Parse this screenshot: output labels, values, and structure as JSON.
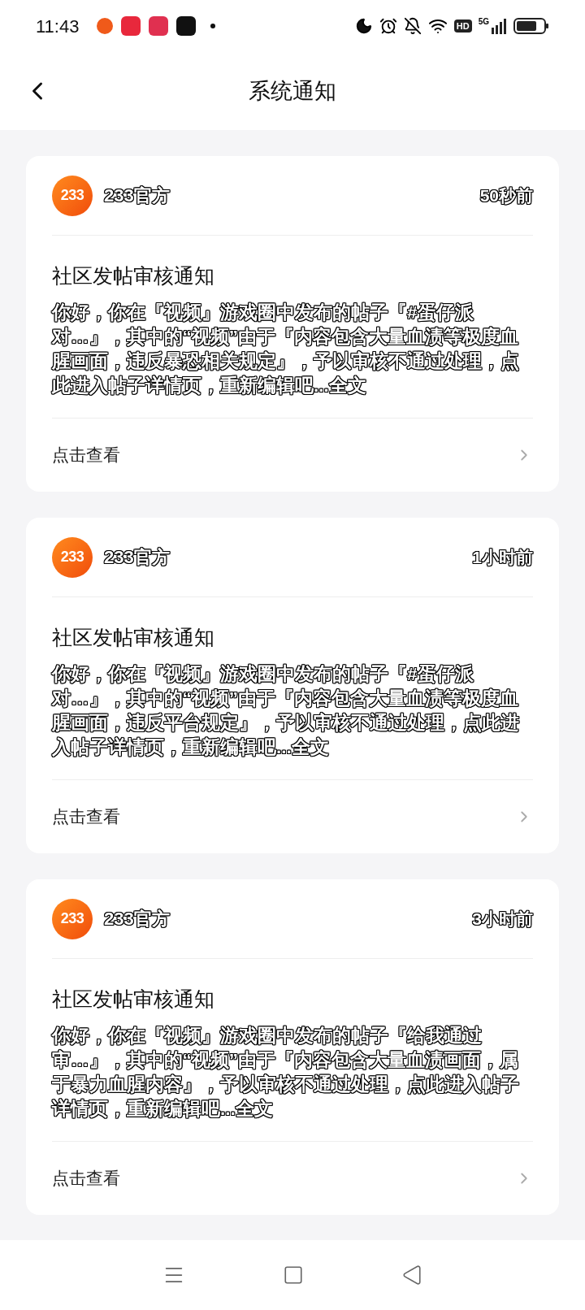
{
  "status_bar": {
    "time": "11:43",
    "network": "5G",
    "hd": "HD"
  },
  "header": {
    "title": "系统通知"
  },
  "notifications": [
    {
      "sender": "233官方",
      "avatar_text": "233",
      "time": "50秒前",
      "title": "社区发帖审核通知",
      "body": "你好，你在『视频』游戏圈中发布的帖子『#蛋仔派对…』，其中的“视频”由于『内容包含大量血渍等极度血腥画面，违反暴恐相关规定』，予以审核不通过处理，点此进入帖子详情页，重新编辑吧...全文",
      "action": "点击查看"
    },
    {
      "sender": "233官方",
      "avatar_text": "233",
      "time": "1小时前",
      "title": "社区发帖审核通知",
      "body": "你好，你在『视频』游戏圈中发布的帖子『#蛋仔派对…』，其中的“视频”由于『内容包含大量血渍等极度血腥画面，违反平台规定』，予以审核不通过处理，点此进入帖子详情页，重新编辑吧...全文",
      "action": "点击查看"
    },
    {
      "sender": "233官方",
      "avatar_text": "233",
      "time": "3小时前",
      "title": "社区发帖审核通知",
      "body": "你好，你在『视频』游戏圈中发布的帖子『给我通过审…』，其中的“视频”由于『内容包含大量血渍画面，属于暴力血腥内容』，予以审核不通过处理，点此进入帖子详情页，重新编辑吧...全文",
      "action": "点击查看"
    }
  ]
}
